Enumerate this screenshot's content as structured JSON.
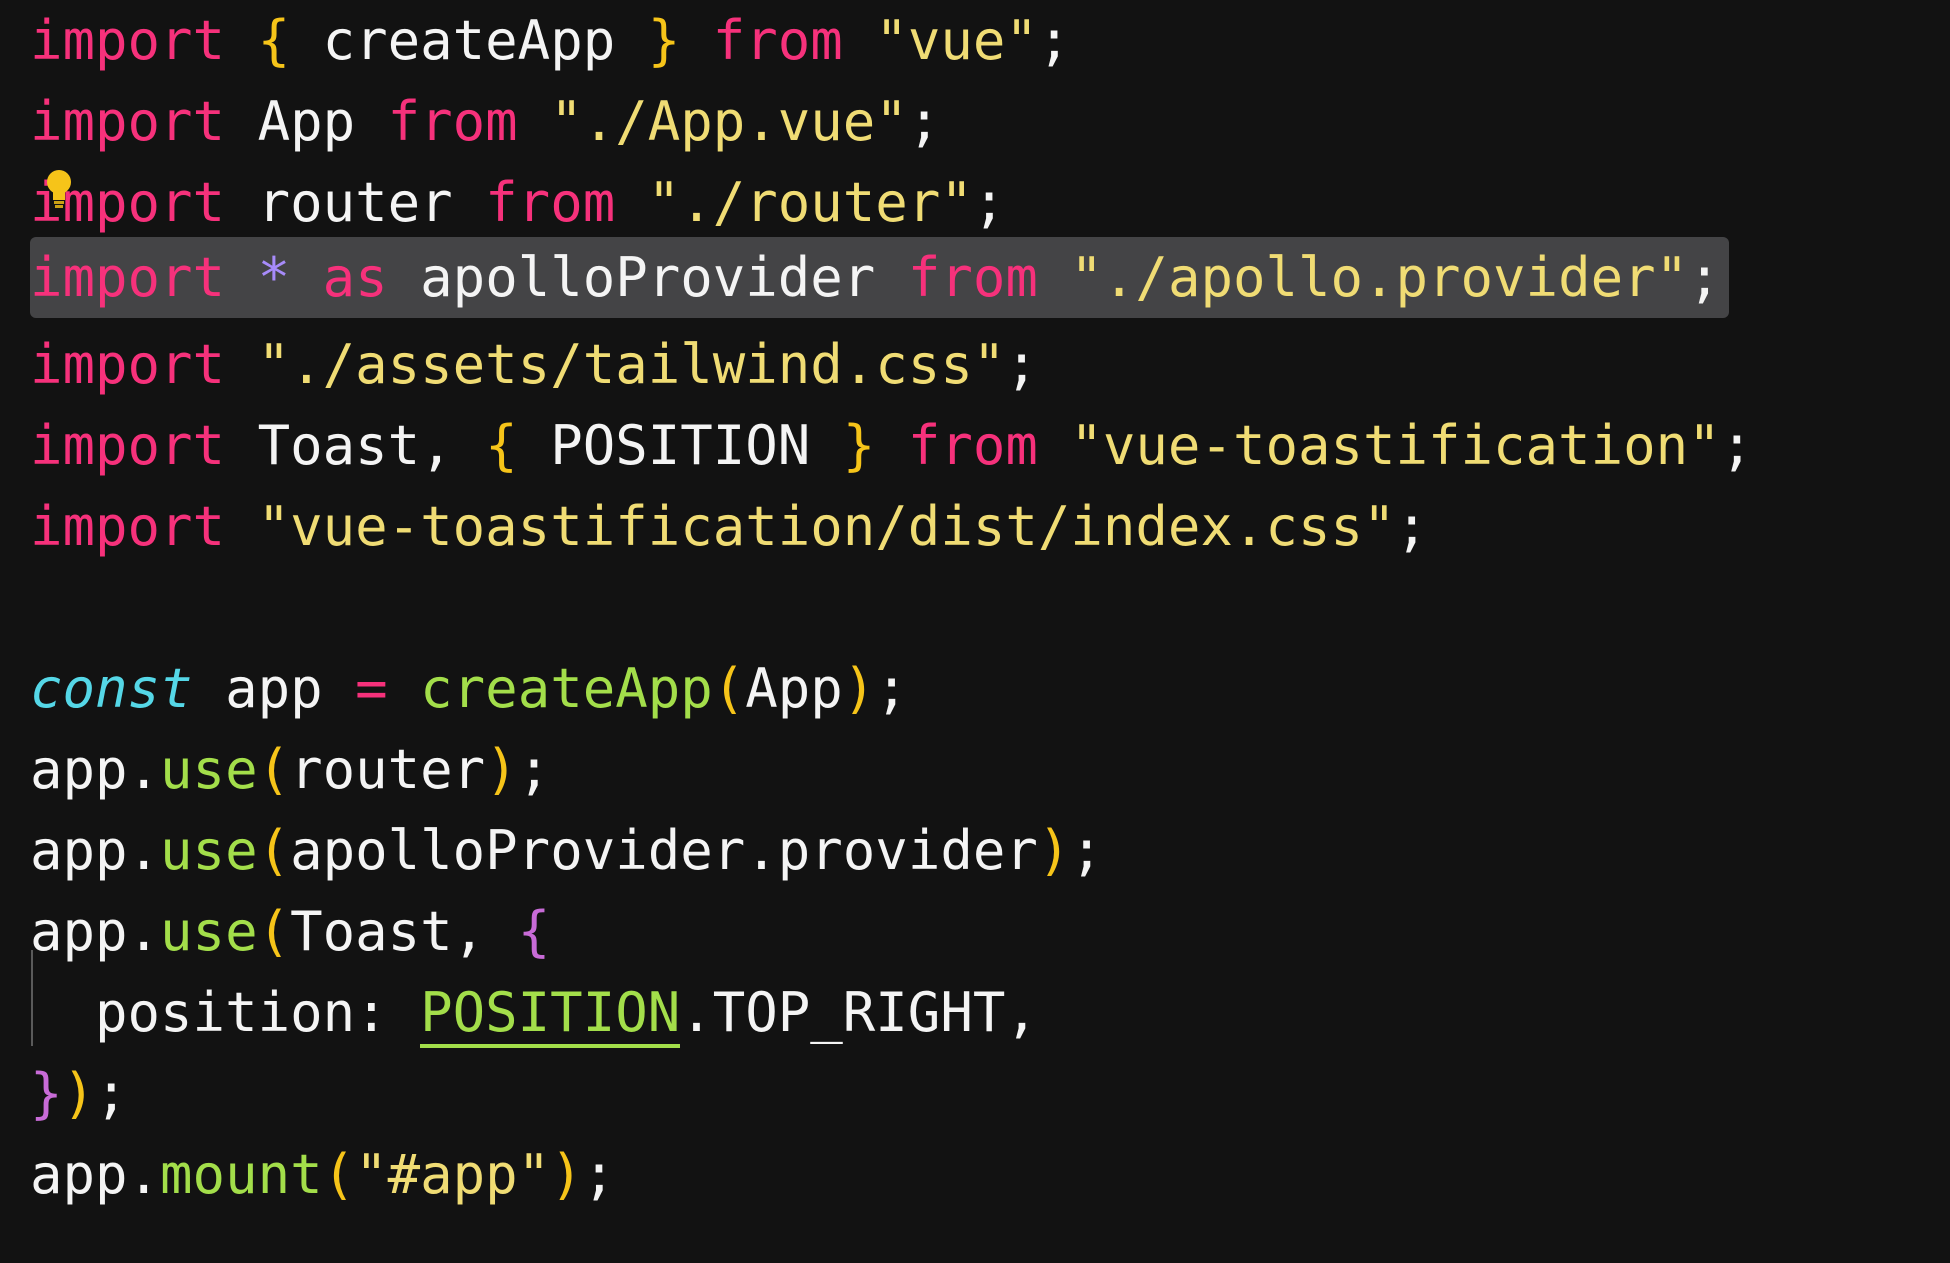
{
  "code": {
    "line1": {
      "kw": "import",
      "sp1": " ",
      "brace_open": "{",
      "name": " createApp ",
      "brace_close": "}",
      "sp2": " ",
      "from": "from",
      "sp3": " ",
      "str": "\"vue\"",
      "semi": ";"
    },
    "line2": {
      "kw": "import",
      "name": " App ",
      "from": "from",
      "sp": " ",
      "str": "\"./App.vue\"",
      "semi": ";"
    },
    "line3": {
      "kw": "import",
      "name": " router ",
      "from": "from",
      "sp": " ",
      "str": "\"./router\"",
      "semi": ";"
    },
    "line4": {
      "kw": "import",
      "ws1": " ",
      "star": "*",
      "ws2": " ",
      "as": "as",
      "ws3": " ",
      "name": "apolloProvider",
      "ws4": " ",
      "from": "from",
      "ws5": " ",
      "str": "\"./apollo.provider\"",
      "semi": ";"
    },
    "line5": {
      "kw": "import",
      "sp": " ",
      "str": "\"./assets/tailwind.css\"",
      "semi": ";"
    },
    "line6": {
      "kw": "import",
      "name": " Toast, ",
      "brace_open": "{",
      "name2": " POSITION ",
      "brace_close": "}",
      "sp": " ",
      "from": "from",
      "sp2": " ",
      "str": "\"vue-toastification\"",
      "semi": ";"
    },
    "line7": {
      "kw": "import",
      "sp": " ",
      "str": "\"vue-toastification/dist/index.css\"",
      "semi": ";"
    },
    "line9": {
      "kw": "const",
      "name": " app ",
      "op": "=",
      "sp": " ",
      "fn": "createApp",
      "paren_open": "(",
      "arg": "App",
      "paren_close": ")",
      "semi": ";"
    },
    "line10": {
      "obj": "app.",
      "fn": "use",
      "paren_open": "(",
      "arg": "router",
      "paren_close": ")",
      "semi": ";"
    },
    "line11": {
      "obj": "app.",
      "fn": "use",
      "paren_open": "(",
      "arg": "apolloProvider.provider",
      "paren_close": ")",
      "semi": ";"
    },
    "line12": {
      "obj": "app.",
      "fn": "use",
      "paren_open": "(",
      "arg": "Toast, ",
      "brace_open": "{"
    },
    "line13": {
      "indent": "  position: ",
      "enum": "POSITION",
      "rest": ".TOP_RIGHT,"
    },
    "line14": {
      "brace_close": "}",
      "paren_close": ")",
      "semi": ";"
    },
    "line15": {
      "obj": "app.",
      "fn": "mount",
      "paren_open": "(",
      "str": "\"#app\"",
      "paren_close": ")",
      "semi": ";"
    }
  },
  "colors": {
    "background": "#121212",
    "keyword": "#f6317b",
    "string": "#f0dc74",
    "function": "#a3de4a",
    "const_keyword": "#55d7e7",
    "brace": "#f6c419",
    "highlight": "#444446"
  },
  "icons": {
    "lightbulb": "lightbulb-icon"
  }
}
